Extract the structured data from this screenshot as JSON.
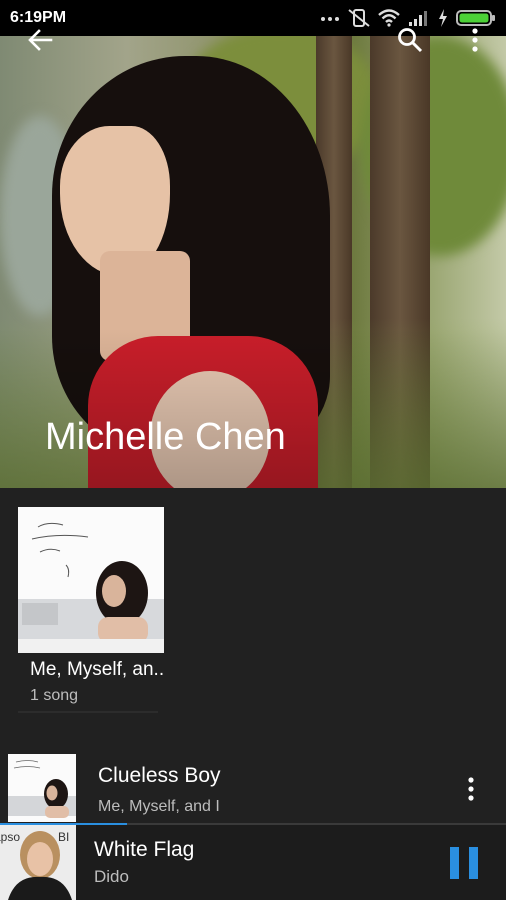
{
  "status_bar": {
    "time": "6:19PM",
    "icons": [
      "overflow-dots-icon",
      "vibrate-off-icon",
      "wifi-icon",
      "signal-icon",
      "charging-icon",
      "battery-icon"
    ]
  },
  "artist": {
    "name": "Michelle Chen"
  },
  "toolbar": {
    "icons": [
      "back-arrow-icon",
      "search-icon",
      "more-vert-icon"
    ]
  },
  "albums": [
    {
      "title": "Me, Myself, an..",
      "subtitle": "1 song"
    }
  ],
  "songs": [
    {
      "title": "Clueless Boy",
      "subtitle": "Me, Myself, and I"
    }
  ],
  "now_playing": {
    "title": "White Flag",
    "artist": "Dido",
    "progress": 0.25,
    "state_icon": "pause-icon"
  },
  "colors": {
    "accent": "#2a8fe0",
    "background": "#212121",
    "battery": "#4cd137"
  }
}
